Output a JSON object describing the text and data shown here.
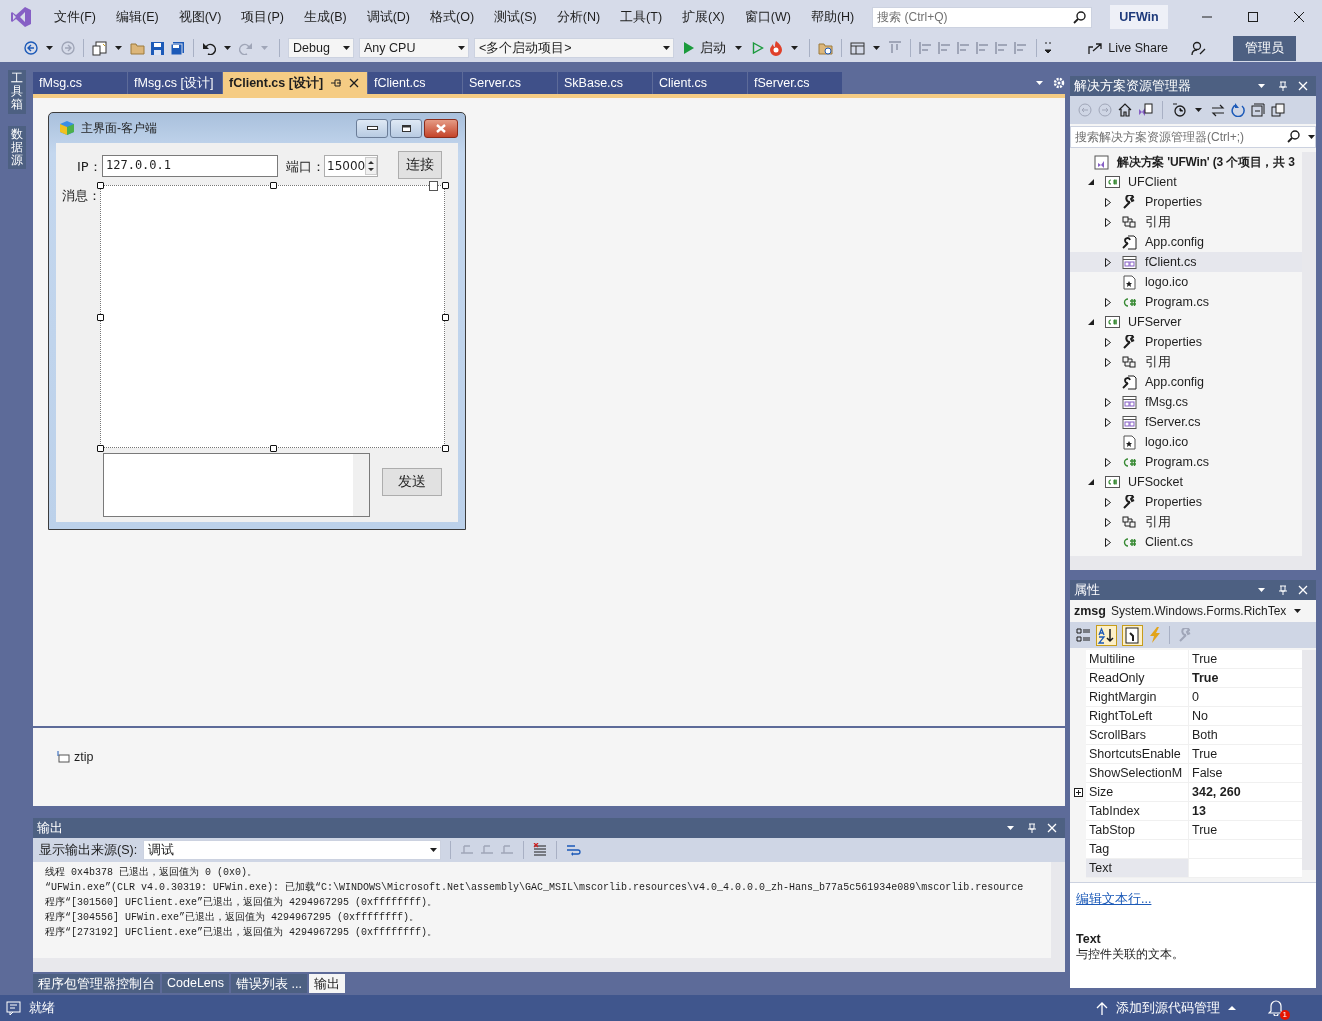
{
  "menu": [
    {
      "label": "文件(F)"
    },
    {
      "label": "编辑(E)"
    },
    {
      "label": "视图(V)"
    },
    {
      "label": "项目(P)"
    },
    {
      "label": "生成(B)"
    },
    {
      "label": "调试(D)"
    },
    {
      "label": "格式(O)"
    },
    {
      "label": "测试(S)"
    },
    {
      "label": "分析(N)"
    },
    {
      "label": "工具(T)"
    },
    {
      "label": "扩展(X)"
    },
    {
      "label": "窗口(W)"
    },
    {
      "label": "帮助(H)"
    }
  ],
  "search": {
    "placeholder": "搜索 (Ctrl+Q)"
  },
  "solution_badge": "UFWin",
  "toolbar": {
    "configuration": "Debug",
    "platform": "Any CPU",
    "startup": "<多个启动项目>",
    "start": "启动",
    "live_share": "Live Share",
    "admin": "管理员"
  },
  "side_tabs": [
    {
      "label": "工具箱"
    },
    {
      "label": "数据源"
    }
  ],
  "doc_tabs": [
    {
      "label": "fMsg.cs",
      "selected": false
    },
    {
      "label": "fMsg.cs [设计]",
      "selected": false
    },
    {
      "label": "fClient.cs [设计]",
      "selected": true
    },
    {
      "label": "fClient.cs",
      "selected": false
    },
    {
      "label": "Server.cs",
      "selected": false
    },
    {
      "label": "SkBase.cs",
      "selected": false
    },
    {
      "label": "Client.cs",
      "selected": false
    },
    {
      "label": "fServer.cs",
      "selected": false
    }
  ],
  "form": {
    "title": "主界面-客户端",
    "ip_label": "IP：",
    "ip_value": "127.0.0.1",
    "port_label": "端口：",
    "port_value": "15000",
    "connect_button": "连接",
    "message_label": "消息：",
    "send_button": "发送"
  },
  "component_tray": [
    {
      "label": "ztip"
    }
  ],
  "output": {
    "title": "输出",
    "source_label": "显示输出来源(S):",
    "source_value": "调试",
    "lines": [
      "线程 0x4b378 已退出，返回值为 0 (0x0)。",
      "“UFWin.exe”(CLR v4.0.30319: UFWin.exe): 已加载“C:\\WINDOWS\\Microsoft.Net\\assembly\\GAC_MSIL\\mscorlib.resources\\v4.0_4.0.0.0_zh-Hans_b77a5c561934e089\\mscorlib.resource",
      "程序“[301560] UFClient.exe”已退出，返回值为 4294967295 (0xffffffff)。",
      "程序“[304556] UFWin.exe”已退出，返回值为 4294967295 (0xffffffff)。",
      "程序“[273192] UFClient.exe”已退出，返回值为 4294967295 (0xffffffff)。"
    ]
  },
  "bottom_tabs": [
    {
      "label": "程序包管理器控制台",
      "selected": false
    },
    {
      "label": "CodeLens",
      "selected": false
    },
    {
      "label": "错误列表 ...",
      "selected": false
    },
    {
      "label": "输出",
      "selected": true
    }
  ],
  "solution_explorer": {
    "title": "解决方案资源管理器",
    "search_placeholder": "搜索解决方案资源管理器(Ctrl+;)",
    "tree": {
      "label": "解决方案 'UFWin' (3 个项目，共 3",
      "kind": "solution",
      "selected": false,
      "children": [
        {
          "label": "UFClient",
          "kind": "project",
          "expanded": true,
          "selected": false,
          "children": [
            {
              "label": "Properties",
              "kind": "properties",
              "expanded": false,
              "selected": false
            },
            {
              "label": "引用",
              "kind": "references",
              "expanded": false,
              "selected": false
            },
            {
              "label": "App.config",
              "kind": "config",
              "selected": false
            },
            {
              "label": "fClient.cs",
              "kind": "form",
              "expanded": false,
              "selected": true
            },
            {
              "label": "logo.ico",
              "kind": "icon_file",
              "selected": false
            },
            {
              "label": "Program.cs",
              "kind": "csharp",
              "expanded": false,
              "selected": false
            }
          ]
        },
        {
          "label": "UFServer",
          "kind": "project",
          "expanded": true,
          "selected": false,
          "children": [
            {
              "label": "Properties",
              "kind": "properties",
              "expanded": false,
              "selected": false
            },
            {
              "label": "引用",
              "kind": "references",
              "expanded": false,
              "selected": false
            },
            {
              "label": "App.config",
              "kind": "config",
              "selected": false
            },
            {
              "label": "fMsg.cs",
              "kind": "form",
              "expanded": false,
              "selected": false
            },
            {
              "label": "fServer.cs",
              "kind": "form",
              "expanded": false,
              "selected": false
            },
            {
              "label": "logo.ico",
              "kind": "icon_file",
              "selected": false
            },
            {
              "label": "Program.cs",
              "kind": "csharp",
              "expanded": false,
              "selected": false
            }
          ]
        },
        {
          "label": "UFSocket",
          "kind": "project",
          "expanded": true,
          "selected": false,
          "children": [
            {
              "label": "Properties",
              "kind": "properties",
              "expanded": false,
              "selected": false
            },
            {
              "label": "引用",
              "kind": "references",
              "expanded": false,
              "selected": false
            },
            {
              "label": "Client.cs",
              "kind": "csharp",
              "expanded": false,
              "selected": false
            }
          ]
        }
      ]
    }
  },
  "properties": {
    "title": "属性",
    "object_name": "zmsg",
    "object_type": "System.Windows.Forms.RichTex",
    "rows": [
      {
        "name": "Multiline",
        "value": "True",
        "modified": false,
        "selected": false
      },
      {
        "name": "ReadOnly",
        "value": "True",
        "modified": true,
        "selected": false
      },
      {
        "name": "RightMargin",
        "value": "0",
        "modified": false,
        "selected": false
      },
      {
        "name": "RightToLeft",
        "value": "No",
        "modified": false,
        "selected": false
      },
      {
        "name": "ScrollBars",
        "value": "Both",
        "modified": false,
        "selected": false
      },
      {
        "name": "ShortcutsEnable",
        "value": "True",
        "modified": false,
        "selected": false
      },
      {
        "name": "ShowSelectionM",
        "value": "False",
        "modified": false,
        "selected": false
      },
      {
        "name": "Size",
        "value": "342, 260",
        "modified": true,
        "selected": false,
        "expanded": false
      },
      {
        "name": "TabIndex",
        "value": "13",
        "modified": true,
        "selected": false
      },
      {
        "name": "TabStop",
        "value": "True",
        "modified": false,
        "selected": false
      },
      {
        "name": "Tag",
        "selected": false
      },
      {
        "name": "Text",
        "selected": true
      }
    ],
    "link": "编辑文本行...",
    "description_title": "Text",
    "description": "与控件关联的文本。"
  },
  "status_bar": {
    "message": "就绪",
    "source_control": "添加到源代码管理",
    "notifications": "1"
  }
}
